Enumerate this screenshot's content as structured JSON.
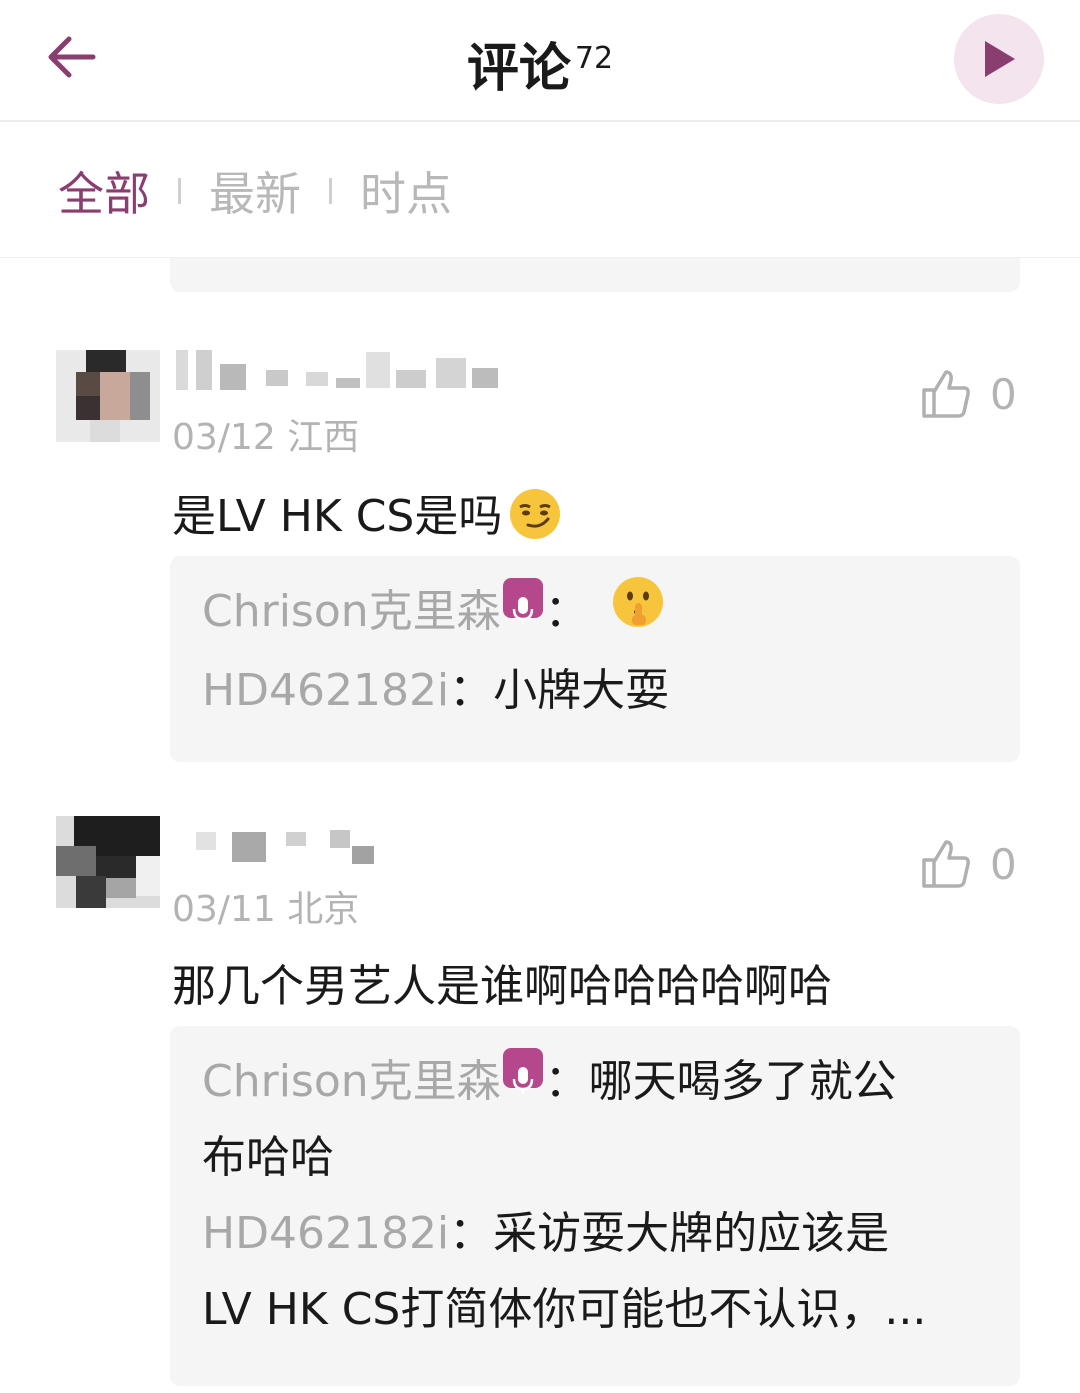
{
  "header": {
    "title": "评论",
    "count": "72"
  },
  "tabs": [
    {
      "label": "全部"
    },
    {
      "label": "最新"
    },
    {
      "label": "时点"
    }
  ],
  "comments": [
    {
      "date": "03/12",
      "location": "江西",
      "likes": "0",
      "text": "是LV HK CS是吗",
      "emoji": "smirk-emoji",
      "replies": [
        {
          "author": "Chrison克里森",
          "sep": "：",
          "text": "",
          "emoji": "shushing-emoji"
        },
        {
          "author": "HD462182i",
          "sep": "：",
          "text": "小牌大耍"
        }
      ]
    },
    {
      "date": "03/11",
      "location": "北京",
      "likes": "0",
      "text": "那几个男艺人是谁啊哈哈哈哈啊哈",
      "replies": [
        {
          "author": "Chrison克里森",
          "sep": "：",
          "text_line1": "哪天喝多了就公",
          "text_line2": "布哈哈"
        },
        {
          "author": "HD462182i",
          "sep": "：",
          "text_line1": "采访耍大牌的应该是",
          "text_line2": "LV HK CS打简体你可能也不认识，..."
        }
      ]
    }
  ],
  "colors": {
    "accent": "#8a3d6f",
    "play_bg": "#f3e4ee",
    "mic_badge": "#b5488c",
    "muted": "#b3b3b3",
    "reply_bg": "#f5f5f5"
  }
}
